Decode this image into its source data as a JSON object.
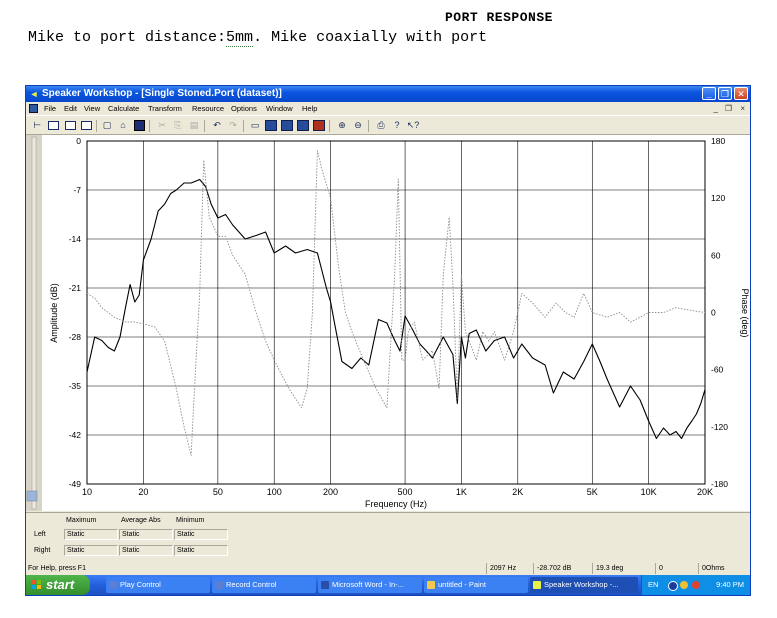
{
  "document": {
    "title": "PORT RESPONSE",
    "caption_prefix": "Mike to port distance:",
    "caption_underlined": "5mm",
    "caption_suffix": ". Mike coaxially with port"
  },
  "window": {
    "title": "Speaker Workshop - [Single Stoned.Port (dataset)]",
    "minimize_glyph": "_",
    "restore_glyph": "❐",
    "close_glyph": "✕",
    "mdi_minimize_glyph": "_",
    "mdi_restore_glyph": "❐",
    "mdi_close_glyph": "×"
  },
  "menu": {
    "items": [
      "File",
      "Edit",
      "View",
      "Calculate",
      "Transform",
      "Resource",
      "Options",
      "Window",
      "Help"
    ]
  },
  "toolbar": {
    "icons": [
      "pointer-icon",
      "chart-view-icon",
      "chart-view-alt-icon",
      "grid-view-icon",
      "new-icon",
      "open-icon",
      "save-icon",
      "cut-icon",
      "copy-icon",
      "paste-icon",
      "undo-icon",
      "redo-icon",
      "open-folder-icon",
      "properties-icon",
      "calculate-icon",
      "network-icon",
      "toolbox-icon",
      "zoom-in-icon",
      "zoom-out-icon",
      "print-icon",
      "help-icon",
      "context-help-icon"
    ]
  },
  "chart_data": {
    "type": "line",
    "xlabel": "Frequency (Hz)",
    "ylabel": "Amplitude (dB)",
    "y2label": "Phase (deg)",
    "xscale": "log",
    "xlim": [
      10,
      20000
    ],
    "ylim": [
      -49,
      0
    ],
    "y2lim": [
      -180,
      180
    ],
    "grid": true,
    "x_ticks": [
      10,
      20,
      50,
      100,
      200,
      500,
      1000,
      2000,
      5000,
      10000,
      20000
    ],
    "x_tick_labels": [
      "10",
      "20",
      "50",
      "100",
      "200",
      "500",
      "1K",
      "2K",
      "5K",
      "10K",
      "20K"
    ],
    "y_ticks": [
      0,
      -7,
      -14,
      -21,
      -28,
      -35,
      -42,
      -49
    ],
    "y_tick_labels": [
      "0",
      "-7",
      "-14",
      "-21",
      "-28",
      "-35",
      "-42",
      "-49"
    ],
    "y2_ticks": [
      180,
      120,
      60,
      0,
      -60,
      -120,
      -180
    ],
    "y2_tick_labels": [
      "180",
      "120",
      "60",
      "0",
      "-60",
      "-120",
      "-180"
    ],
    "series": [
      {
        "style": "solid",
        "color": "#000000",
        "axis": "left",
        "x": [
          10,
          11,
          12,
          13,
          14,
          15,
          16,
          17,
          18,
          19,
          20,
          22,
          24,
          26,
          28,
          30,
          33,
          36,
          40,
          43,
          46,
          50,
          55,
          60,
          70,
          80,
          90,
          100,
          115,
          130,
          150,
          170,
          190,
          200,
          210,
          230,
          260,
          290,
          320,
          360,
          400,
          440,
          470,
          500,
          550,
          600,
          650,
          700,
          800,
          900,
          950,
          1000,
          1050,
          1100,
          1200,
          1350,
          1500,
          1700,
          1900,
          2100,
          2400,
          2800,
          3100,
          3500,
          4000,
          4500,
          5000,
          5500,
          6000,
          7000,
          8000,
          9000,
          10000,
          11000,
          12000,
          13000,
          14000,
          15000,
          16000,
          17000,
          18000,
          19000,
          20000
        ],
        "y": [
          -33,
          -28,
          -28.5,
          -29.5,
          -30,
          -28,
          -24,
          -20.5,
          -23,
          -22,
          -17,
          -14,
          -10,
          -9,
          -7.5,
          -7,
          -6,
          -6,
          -5.5,
          -6.5,
          -9,
          -11,
          -10.5,
          -12,
          -14,
          -13.5,
          -13,
          -16,
          -15,
          -16,
          -15.5,
          -16,
          -21,
          -23,
          -26,
          -31.5,
          -32.5,
          -31,
          -32,
          -25.5,
          -26,
          -28.5,
          -30,
          -25,
          -27,
          -29,
          -30,
          -31,
          -28,
          -30.5,
          -37.5,
          -28,
          -31,
          -27.5,
          -27,
          -30,
          -28.5,
          -28,
          -31,
          -29,
          -31,
          -32,
          -36,
          -33,
          -34,
          -31.5,
          -29,
          -31.5,
          -34,
          -38,
          -35,
          -37,
          -40,
          -42.5,
          -41,
          -42,
          -41.5,
          -42.5,
          -41,
          -40,
          -39,
          -37.5,
          -35.5
        ]
      },
      {
        "style": "dotted",
        "color": "#8c8c8c",
        "axis": "right",
        "x": [
          10,
          11,
          12,
          14,
          16,
          18,
          20,
          23,
          26,
          30,
          33,
          36,
          38,
          40,
          42,
          45,
          50,
          55,
          60,
          70,
          80,
          90,
          100,
          120,
          140,
          150,
          160,
          170,
          180,
          200,
          220,
          240,
          260,
          300,
          350,
          400,
          440,
          460,
          480,
          500,
          520,
          560,
          620,
          700,
          760,
          800,
          860,
          900,
          950,
          1000,
          1050,
          1100,
          1200,
          1300,
          1400,
          1500,
          1700,
          1900,
          2100,
          2400,
          2800,
          3200,
          3600,
          4000,
          4500,
          5000,
          6000,
          7000,
          8000,
          9000,
          10000,
          12000,
          14000,
          17000,
          20000
        ],
        "y": [
          20,
          15,
          5,
          -5,
          -10,
          -10,
          -12,
          -15,
          -30,
          -80,
          -120,
          -150,
          -60,
          20,
          160,
          100,
          80,
          80,
          60,
          40,
          0,
          -30,
          -50,
          -80,
          -100,
          -80,
          0,
          170,
          150,
          120,
          50,
          0,
          -20,
          -50,
          -80,
          -100,
          40,
          140,
          -50,
          -50,
          -20,
          -10,
          -50,
          -40,
          -80,
          40,
          100,
          30,
          -90,
          40,
          -20,
          -30,
          -50,
          -20,
          -30,
          -20,
          -50,
          -20,
          20,
          10,
          -5,
          10,
          0,
          -5,
          20,
          0,
          -5,
          0,
          -10,
          -5,
          0,
          0,
          5,
          2,
          0
        ]
      }
    ]
  },
  "stats": {
    "headers": [
      "Maximum",
      "Average Abs",
      "Minimum"
    ],
    "rows": [
      {
        "label": "Left",
        "values": [
          "Static",
          "Static",
          "Static"
        ]
      },
      {
        "label": "Right",
        "values": [
          "Static",
          "Static",
          "Static"
        ]
      }
    ]
  },
  "status": {
    "help": "For Help, press F1",
    "frequency": "2097 Hz",
    "amplitude": "-28.702 dB",
    "phase": "19.3 deg",
    "value": "0",
    "impedance": "0Ohms"
  },
  "taskbar": {
    "start": "start",
    "tasks": [
      {
        "label": "Play Control",
        "color": "#5b7fd4"
      },
      {
        "label": "Record Control",
        "color": "#5b7fd4"
      },
      {
        "label": "Microsoft Word - In-...",
        "color": "#2a4ea8"
      },
      {
        "label": "untitled - Paint",
        "color": "#f2c94c"
      },
      {
        "label": "Speaker Workshop -...",
        "color": "#e6f24a"
      }
    ],
    "lang": "EN",
    "clock": "9:40 PM"
  }
}
